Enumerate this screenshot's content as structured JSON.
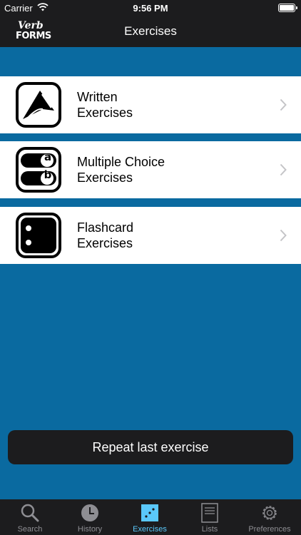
{
  "status_bar": {
    "carrier": "Carrier",
    "time": "9:56 PM"
  },
  "nav": {
    "logo_line1": "Verb",
    "logo_line2": "FORMS",
    "title": "Exercises"
  },
  "exercises": [
    {
      "line1": "Written",
      "line2": "Exercises",
      "icon": "written-icon"
    },
    {
      "line1": "Multiple Choice",
      "line2": "Exercises",
      "icon": "multiple-choice-icon",
      "choice_a": "a",
      "choice_b": "b"
    },
    {
      "line1": "Flashcard",
      "line2": "Exercises",
      "icon": "flashcard-icon"
    }
  ],
  "repeat_button": "Repeat last exercise",
  "tabs": [
    {
      "label": "Search",
      "icon": "search-icon"
    },
    {
      "label": "History",
      "icon": "clock-icon"
    },
    {
      "label": "Exercises",
      "icon": "dice-icon",
      "active": true
    },
    {
      "label": "Lists",
      "icon": "list-icon"
    },
    {
      "label": "Preferences",
      "icon": "gear-icon"
    }
  ],
  "colors": {
    "background": "#0a6aa0",
    "bar": "#1c1c1e",
    "active_tab": "#5ac8fa",
    "inactive_tab": "#8e8e93"
  }
}
